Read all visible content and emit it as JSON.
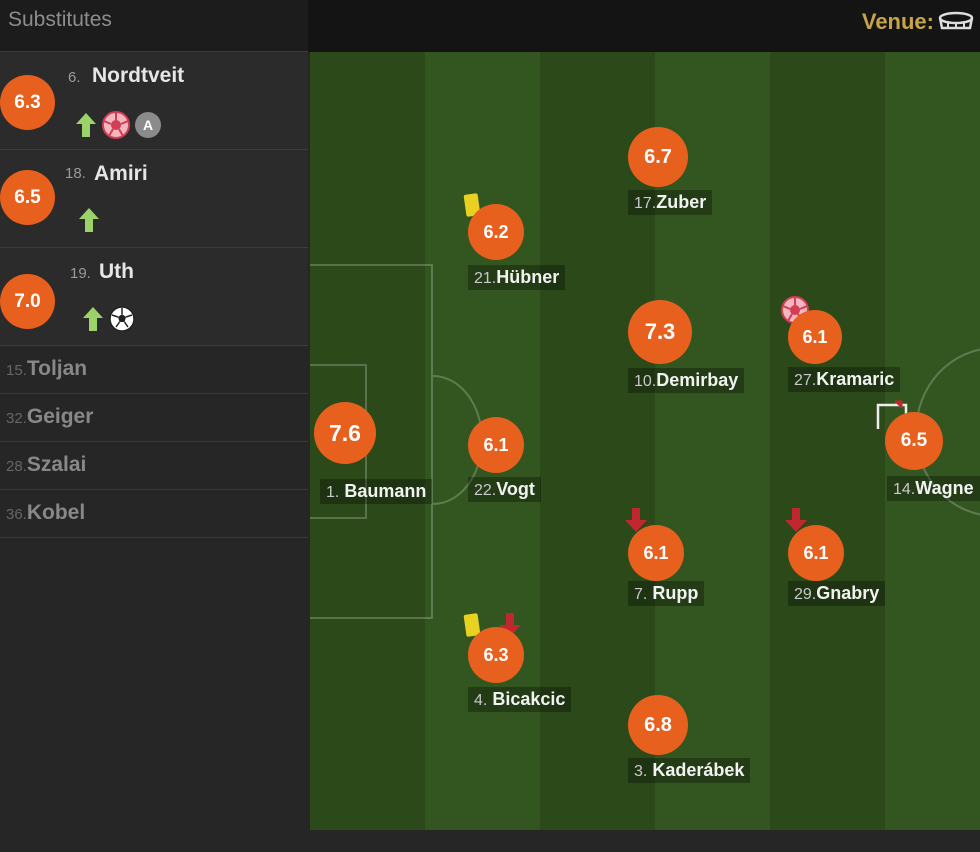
{
  "sidebar": {
    "title": "Substitutes",
    "subs_played": [
      {
        "rating": "6.3",
        "number": "6.",
        "name": "Nordtveit",
        "icons": [
          "sub-on-arrow-icon",
          "own-goal-ball-icon",
          "assist-badge-icon"
        ],
        "assist_letter": "A"
      },
      {
        "rating": "6.5",
        "number": "18.",
        "name": "Amiri",
        "icons": [
          "sub-on-arrow-icon"
        ]
      },
      {
        "rating": "7.0",
        "number": "19.",
        "name": "Uth",
        "icons": [
          "sub-on-arrow-icon",
          "goal-ball-icon"
        ]
      }
    ],
    "subs_unused": [
      {
        "number": "15.",
        "name": "Toljan"
      },
      {
        "number": "32.",
        "name": "Geiger"
      },
      {
        "number": "28.",
        "name": "Szalai"
      },
      {
        "number": "36.",
        "name": "Kobel"
      }
    ]
  },
  "header": {
    "venue_label": "Venue:",
    "venue_icon": "stadium-icon"
  },
  "players": [
    {
      "rating": "7.6",
      "number": "1.",
      "name": "Baumann"
    },
    {
      "rating": "6.2",
      "number": "21.",
      "name": "Hübner",
      "icons": [
        "yellow-card-icon"
      ]
    },
    {
      "rating": "6.1",
      "number": "22.",
      "name": "Vogt"
    },
    {
      "rating": "6.3",
      "number": "4.",
      "name": "Bicakcic",
      "icons": [
        "yellow-card-icon",
        "sub-off-arrow-icon"
      ]
    },
    {
      "rating": "6.7",
      "number": "17.",
      "name": "Zuber"
    },
    {
      "rating": "7.3",
      "number": "10.",
      "name": "Demirbay"
    },
    {
      "rating": "6.1",
      "number": "7.",
      "name": "Rupp",
      "icons": [
        "sub-off-arrow-icon"
      ]
    },
    {
      "rating": "6.8",
      "number": "3.",
      "name": "Kaderábek"
    },
    {
      "rating": "6.1",
      "number": "27.",
      "name": "Kramaric",
      "icons": [
        "own-goal-ball-icon"
      ]
    },
    {
      "rating": "6.1",
      "number": "29.",
      "name": "Gnabry",
      "icons": [
        "sub-off-arrow-icon"
      ]
    },
    {
      "rating": "6.5",
      "number": "14.",
      "name": "Wagne",
      "icons": [
        "corner-flag-icon"
      ]
    }
  ],
  "colors": {
    "rating": "#e8601e",
    "pitch_dark": "#2c4a19",
    "pitch_light": "#335620",
    "venue": "#c6a54a",
    "sub_on": "#9bd36a",
    "sub_off": "#c0282d",
    "yellow_card": "#e8d21f"
  }
}
